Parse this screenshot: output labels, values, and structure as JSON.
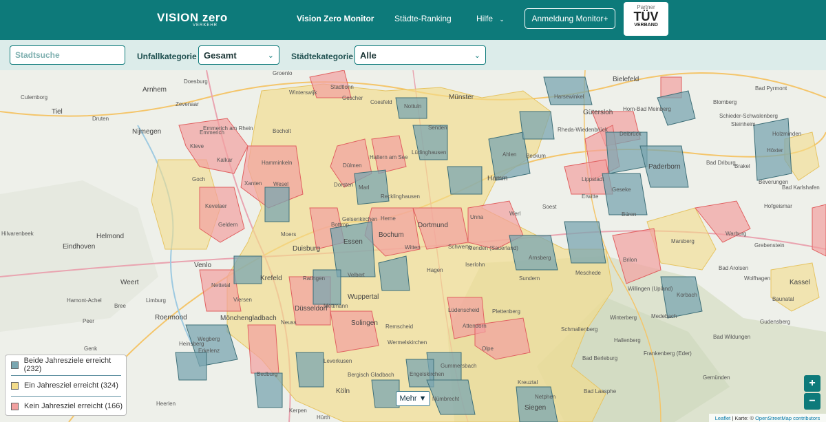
{
  "header": {
    "logo_text": "VISION zero",
    "logo_sub": "VERKEHR",
    "nav": [
      "Vision Zero Monitor",
      "Städte-Ranking",
      "Hilfe"
    ],
    "login_label": "Anmeldung Monitor+",
    "partner_label": "Partner",
    "partner_brand": "TÜV",
    "partner_brand_sub": "VERBAND"
  },
  "filters": {
    "search_placeholder": "Stadtsuche",
    "accident_label": "Unfallkategorie",
    "accident_value": "Gesamt",
    "city_label": "Städtekategorie",
    "city_value": "Alle"
  },
  "legend": {
    "items": [
      {
        "label": "Beide Jahresziele erreicht (232)",
        "color": "#7aa6b0"
      },
      {
        "label": "Ein Jahresziel erreicht (324)",
        "color": "#f3dc8a"
      },
      {
        "label": "Kein Jahresziel erreicht (166)",
        "color": "#f2a0a0"
      }
    ]
  },
  "map": {
    "more_label": "Mehr ▼",
    "zoom_in": "+",
    "zoom_out": "−",
    "attribution_leaflet": "Leaflet",
    "attribution_mid": " | Karte: © ",
    "attribution_osm": "OpenStreetMap contributors",
    "places": [
      "Groenlo",
      "Stadtlohn",
      "Bielefeld",
      "Arnhem",
      "Doesburg",
      "Culemborg",
      "Zevenaar",
      "Tiel",
      "Druten",
      "Winterswijk",
      "Münster",
      "Gescher",
      "Coesfeld",
      "Nottuln",
      "Harsewinkel",
      "Gütersloh",
      "Horn-Bad Meinberg",
      "Blomberg",
      "Schieder-Schwalenberg",
      "Bad Pyrmont",
      "Steinheim",
      "Nijmegen",
      "Emmerich am Rhein",
      "Bocholt",
      "Kleve",
      "Kalkar",
      "Wesel",
      "Hamminkeln",
      "Xanten",
      "Dülmen",
      "Haltern am See",
      "Lüdinghausen",
      "Senden",
      "Ahlen",
      "Beckum",
      "Rheda-Wiedenbrück",
      "Paderborn",
      "Delbrück",
      "Lippstadt",
      "Geseke",
      "Büren",
      "Soest",
      "Hamm",
      "Werl",
      "Unna",
      "Erwitte",
      "Holzminden",
      "Höxter",
      "Brakel",
      "Bad Driburg",
      "Warburg",
      "Marsberg",
      "Brilon",
      "Meschede",
      "Arnsberg",
      "Sundern",
      "Recklinghausen",
      "Marl",
      "Dorsten",
      "Gelsenkirchen",
      "Bottrop",
      "Essen",
      "Bochum",
      "Dortmund",
      "Herne",
      "Witten",
      "Hagen",
      "Schwerte",
      "Iserlohn",
      "Menden (Sauerland)",
      "Duisburg",
      "Moers",
      "Krefeld",
      "Düsseldorf",
      "Mönchengladbach",
      "Neuss",
      "Solingen",
      "Wuppertal",
      "Remscheid",
      "Velbert",
      "Ratingen",
      "Mettmann",
      "Viersen",
      "Nettetal",
      "Venlo",
      "Geldern",
      "Kevelaer",
      "Goch",
      "Emmerich",
      "Wermelskirchen",
      "Leverkusen",
      "Bergisch Gladbach",
      "Köln",
      "Gummersbach",
      "Lüdenscheid",
      "Plettenberg",
      "Attendorn",
      "Olpe",
      "Siegen",
      "Bad Berleburg",
      "Schmallenberg",
      "Winterberg",
      "Hallenberg",
      "Korbach",
      "Kassel",
      "Medebach",
      "Willingen (Upland)",
      "Bad Arolsen",
      "Wolfhagen",
      "Baunatal",
      "Helmond",
      "Eindhoven",
      "Roermond",
      "Weert",
      "Hilvarenbeek",
      "Bree",
      "Limburg",
      "Hamont-Achel",
      "Peer",
      "Genk",
      "Heerlen",
      "Erkelenz",
      "Wegberg",
      "Heinsberg",
      "Bedburg",
      "Kerpen",
      "Hürth",
      "Engelskirchen",
      "Nümbrecht",
      "Kreuztal",
      "Netphen",
      "Frankenberg (Eder)",
      "Bad Wildungen",
      "Gudensberg",
      "Bad Laasphe",
      "Gemünden",
      "Beverungen",
      "Bad Karlshafen",
      "Grebenstein",
      "Hofgeismar"
    ]
  }
}
